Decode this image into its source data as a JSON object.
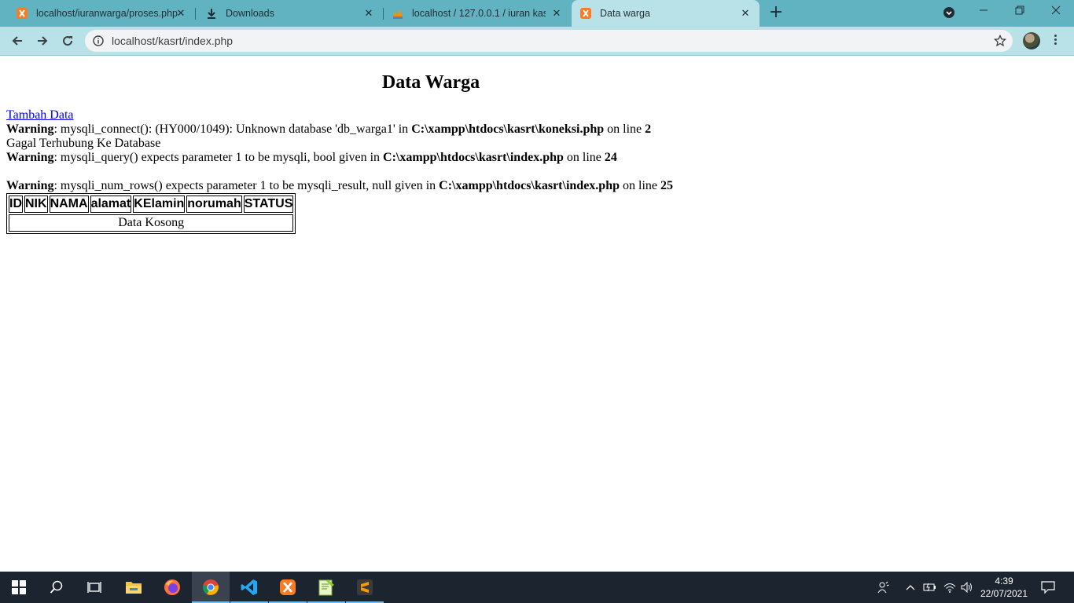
{
  "browser": {
    "tabs": [
      {
        "title": "localhost/iuranwarga/proses.php",
        "favicon": "xampp-icon"
      },
      {
        "title": "Downloads",
        "favicon": "download-icon"
      },
      {
        "title": "localhost / 127.0.0.1 / iuran kas /",
        "favicon": "phpmyadmin-icon"
      },
      {
        "title": "Data warga",
        "favicon": "xampp-icon",
        "active": true
      }
    ],
    "address": "localhost/kasrt/index.php",
    "colors": {
      "tabstrip": "#62b3c1",
      "toolbar": "#b9e2e8"
    }
  },
  "page": {
    "title": "Data Warga",
    "add_link": "Tambah Data",
    "warning1": {
      "label": "Warning",
      "text": ": mysqli_connect(): (HY000/1049): Unknown database 'db_warga1' in ",
      "file": "C:\\xampp\\htdocs\\kasrt\\koneksi.php",
      "on_line": " on line ",
      "line": "2"
    },
    "connection_failed": "Gagal Terhubung Ke Database",
    "warning2": {
      "label": "Warning",
      "text": ": mysqli_query() expects parameter 1 to be mysqli, bool given in ",
      "file": "C:\\xampp\\htdocs\\kasrt\\index.php",
      "on_line": " on line ",
      "line": "24"
    },
    "warning3": {
      "label": "Warning",
      "text": ": mysqli_num_rows() expects parameter 1 to be mysqli_result, null given in ",
      "file": "C:\\xampp\\htdocs\\kasrt\\index.php",
      "on_line": " on line ",
      "line": "25"
    },
    "table": {
      "headers": [
        "ID",
        "NIK",
        "NAMA",
        "alamat",
        "KElamin",
        "norumah",
        "STATUS"
      ],
      "empty_message": "Data Kosong"
    }
  },
  "taskbar": {
    "apps": [
      "start-icon",
      "search-icon",
      "task-view-icon",
      "file-explorer-icon",
      "firefox-icon",
      "chrome-icon",
      "vscode-icon",
      "xampp-icon",
      "notepad-plus-icon",
      "sublime-text-icon"
    ],
    "time": "4:39",
    "date": "22/07/2021"
  }
}
